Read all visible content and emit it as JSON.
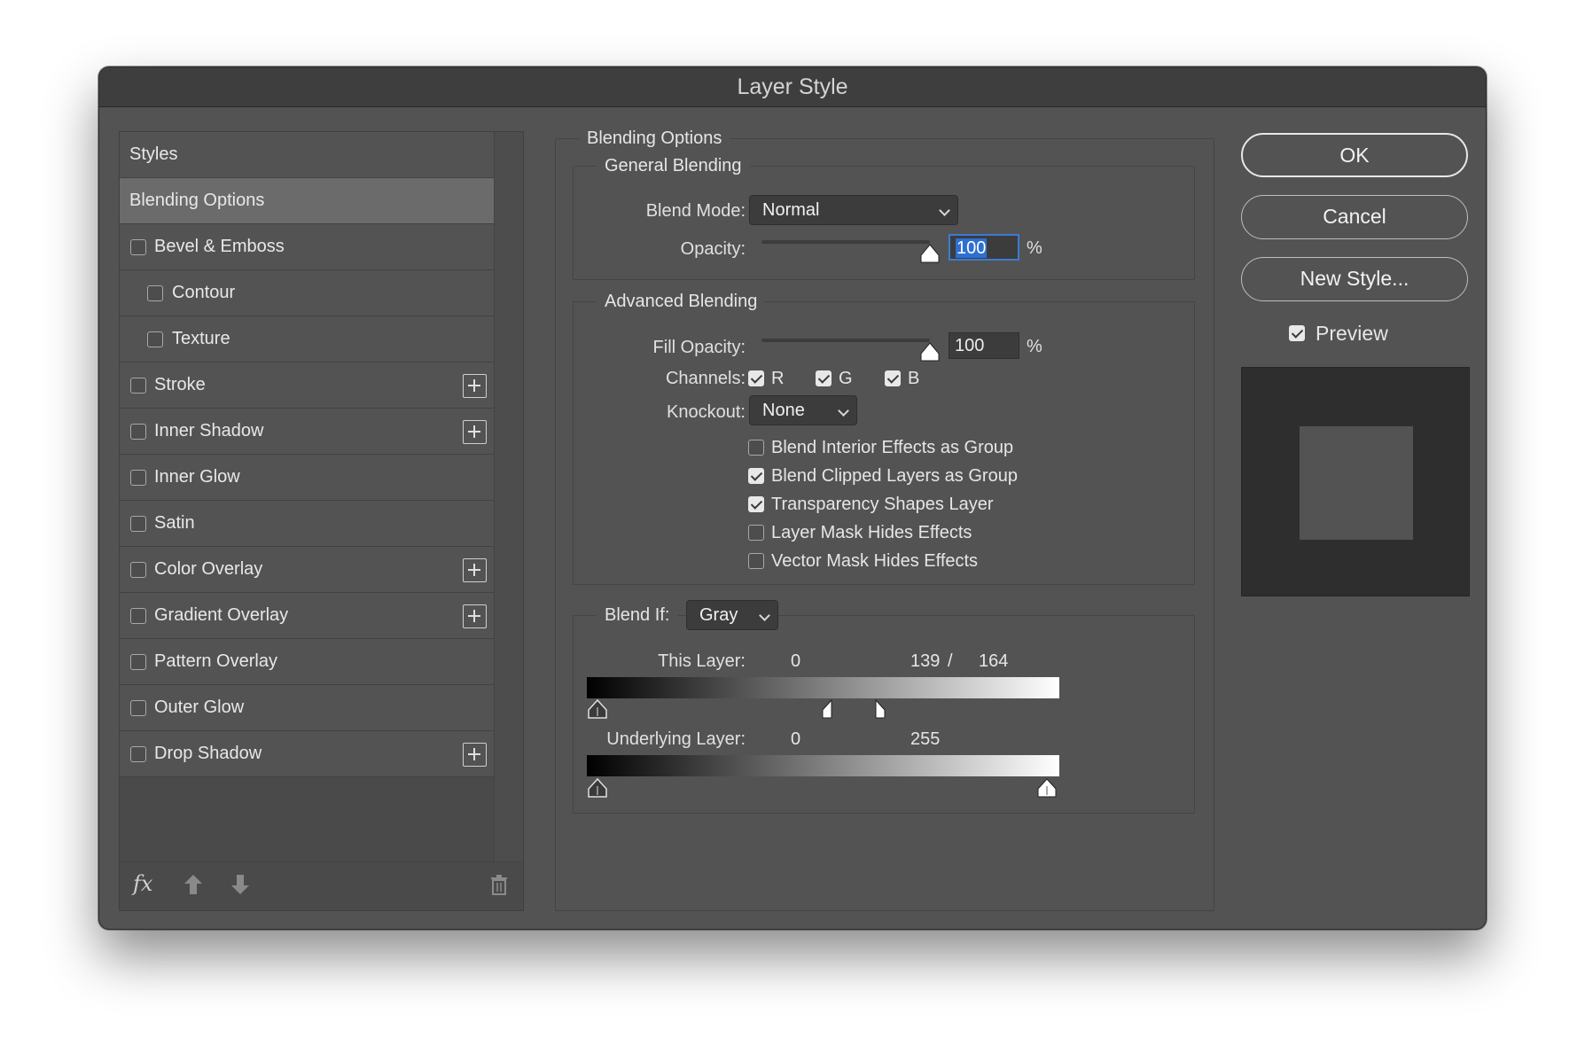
{
  "window": {
    "title": "Layer Style"
  },
  "styles_panel": {
    "items": [
      {
        "label": "Styles",
        "type": "header",
        "checked": false,
        "active": false,
        "has_plus": false
      },
      {
        "label": "Blending Options",
        "type": "header",
        "checked": false,
        "active": true,
        "has_plus": false
      },
      {
        "label": "Bevel & Emboss",
        "type": "checkbox",
        "checked": false,
        "active": false,
        "has_plus": false
      },
      {
        "label": "Contour",
        "type": "sub",
        "checked": false,
        "active": false,
        "has_plus": false
      },
      {
        "label": "Texture",
        "type": "sub",
        "checked": false,
        "active": false,
        "has_plus": false
      },
      {
        "label": "Stroke",
        "type": "checkbox",
        "checked": false,
        "active": false,
        "has_plus": true
      },
      {
        "label": "Inner Shadow",
        "type": "checkbox",
        "checked": false,
        "active": false,
        "has_plus": true
      },
      {
        "label": "Inner Glow",
        "type": "checkbox",
        "checked": false,
        "active": false,
        "has_plus": false
      },
      {
        "label": "Satin",
        "type": "checkbox",
        "checked": false,
        "active": false,
        "has_plus": false
      },
      {
        "label": "Color Overlay",
        "type": "checkbox",
        "checked": false,
        "active": false,
        "has_plus": true
      },
      {
        "label": "Gradient Overlay",
        "type": "checkbox",
        "checked": false,
        "active": false,
        "has_plus": true
      },
      {
        "label": "Pattern Overlay",
        "type": "checkbox",
        "checked": false,
        "active": false,
        "has_plus": false
      },
      {
        "label": "Outer Glow",
        "type": "checkbox",
        "checked": false,
        "active": false,
        "has_plus": false
      },
      {
        "label": "Drop Shadow",
        "type": "checkbox",
        "checked": false,
        "active": false,
        "has_plus": true
      }
    ],
    "footer_icons": [
      "fx-icon",
      "move-up-icon",
      "move-down-icon",
      "trash-icon"
    ],
    "fx_label": "fx"
  },
  "blending": {
    "section_title": "Blending Options",
    "general": {
      "title": "General Blending",
      "blend_mode_label": "Blend Mode:",
      "blend_mode_value": "Normal",
      "opacity_label": "Opacity:",
      "opacity_value": "100",
      "opacity_fraction": 1.0,
      "percent": "%"
    },
    "advanced": {
      "title": "Advanced Blending",
      "fill_opacity_label": "Fill Opacity:",
      "fill_opacity_value": "100",
      "fill_opacity_fraction": 1.0,
      "percent": "%",
      "channels_label": "Channels:",
      "channels": [
        {
          "label": "R",
          "checked": true
        },
        {
          "label": "G",
          "checked": true
        },
        {
          "label": "B",
          "checked": true
        }
      ],
      "knockout_label": "Knockout:",
      "knockout_value": "None",
      "options": [
        {
          "label": "Blend Interior Effects as Group",
          "checked": false
        },
        {
          "label": "Blend Clipped Layers as Group",
          "checked": true
        },
        {
          "label": "Transparency Shapes Layer",
          "checked": true
        },
        {
          "label": "Layer Mask Hides Effects",
          "checked": false
        },
        {
          "label": "Vector Mask Hides Effects",
          "checked": false
        }
      ]
    },
    "blend_if": {
      "label": "Blend If:",
      "value": "Gray",
      "this_layer_label": "This Layer:",
      "this_layer_low": "0",
      "this_layer_high_a": "139",
      "this_layer_sep": "/",
      "this_layer_high_b": "164",
      "underlying_label": "Underlying Layer:",
      "underlying_low": "0",
      "underlying_high": "255"
    }
  },
  "buttons": {
    "ok": "OK",
    "cancel": "Cancel",
    "new_style": "New Style..."
  },
  "preview": {
    "label": "Preview",
    "checked": true
  }
}
